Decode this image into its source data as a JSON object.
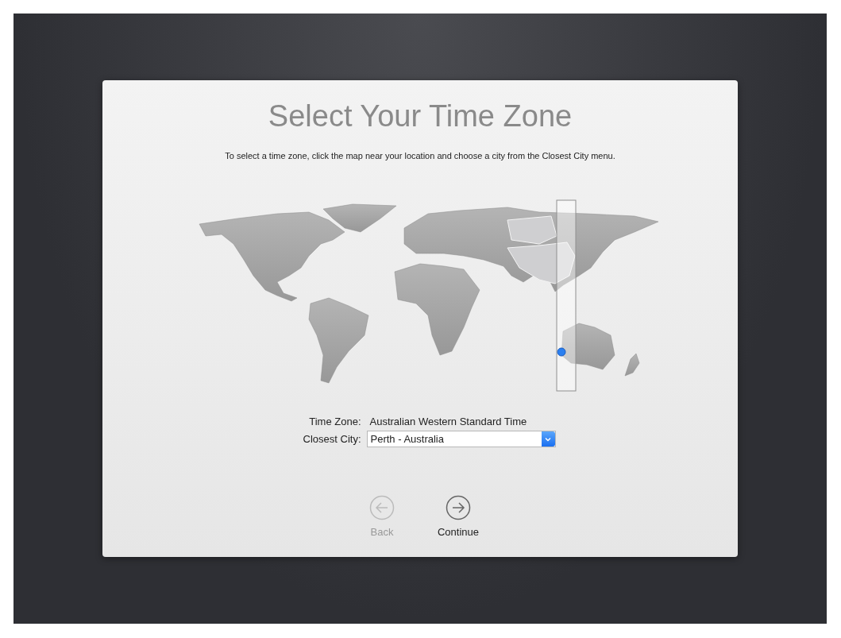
{
  "title": "Select Your Time Zone",
  "instruction": "To select a time zone, click the map near your location and choose a city from the Closest City menu.",
  "time_zone": {
    "label": "Time Zone:",
    "value": "Australian Western Standard Time"
  },
  "closest_city": {
    "label": "Closest City:",
    "value": "Perth - Australia"
  },
  "buttons": [
    {
      "kind": "back",
      "label": "Back",
      "disabled": true
    },
    {
      "kind": "continue",
      "label": "Continue",
      "disabled": false
    }
  ]
}
